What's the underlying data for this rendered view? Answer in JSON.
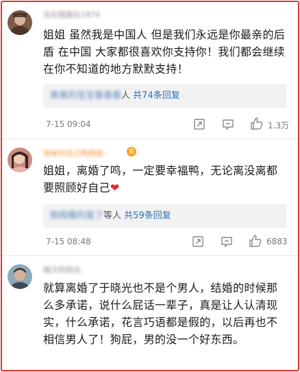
{
  "comments": [
    {
      "username": "淡化假面在1874",
      "text": "姐姐 虽然我是中国人 但是我们永远是你最亲的后盾 在中国 大家都很喜欢你支持你！我们都会继续在你不知道的地方默默支持！",
      "reply_users": "美美的宝宝香香香",
      "reply_suffix": "人",
      "reply_count": "共74条回复",
      "time": "7-15 09:04",
      "likes": "1.3万"
    },
    {
      "username": "捧被你自己鸭婉婉",
      "vip_badge": "会",
      "text": "姐姐，离婚了鸣，一定要幸福鸭，无论离没离都要照顾好自己",
      "emoji": "❤",
      "reply_users": "假假暖的直了",
      "reply_suffix": "等人",
      "reply_count": "共59条回复",
      "time": "7-15 08:48",
      "likes": "6883"
    },
    {
      "username": "帽子的阳光",
      "text": "就算离婚了于晓光也不是个男人，结婚的时候那么多承诺，说什么屁话一辈子，真是让人认清现实，什么承诺，花言巧语都是假的，以后再也不相信男人了！狗屁，男的没一个好东西。"
    }
  ],
  "icons": {
    "share": "share-icon",
    "comment": "comment-icon",
    "like": "thumbs-up-icon"
  },
  "colors": {
    "frame": "#e3342f",
    "link": "#2f6eb5",
    "username": "#f59a3a",
    "heart": "#e8252b"
  }
}
